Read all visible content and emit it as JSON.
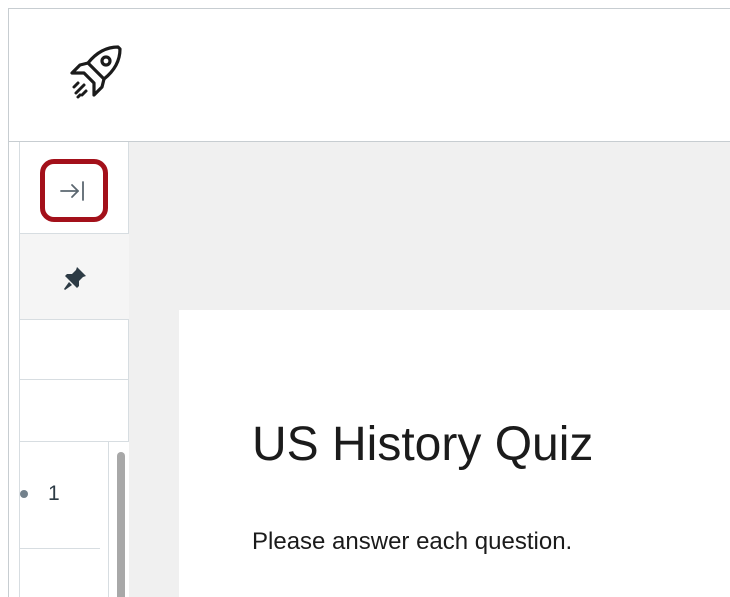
{
  "header": {
    "logo_icon": "rocket-icon"
  },
  "sidebar": {
    "collapse_icon": "arrow-to-right-icon",
    "collapse_highlight_color": "#a3101a",
    "pin_icon": "pushpin-icon",
    "questions": [
      {
        "number": "1"
      }
    ]
  },
  "quiz": {
    "title": "US History Quiz",
    "instructions": "Please answer each question."
  }
}
